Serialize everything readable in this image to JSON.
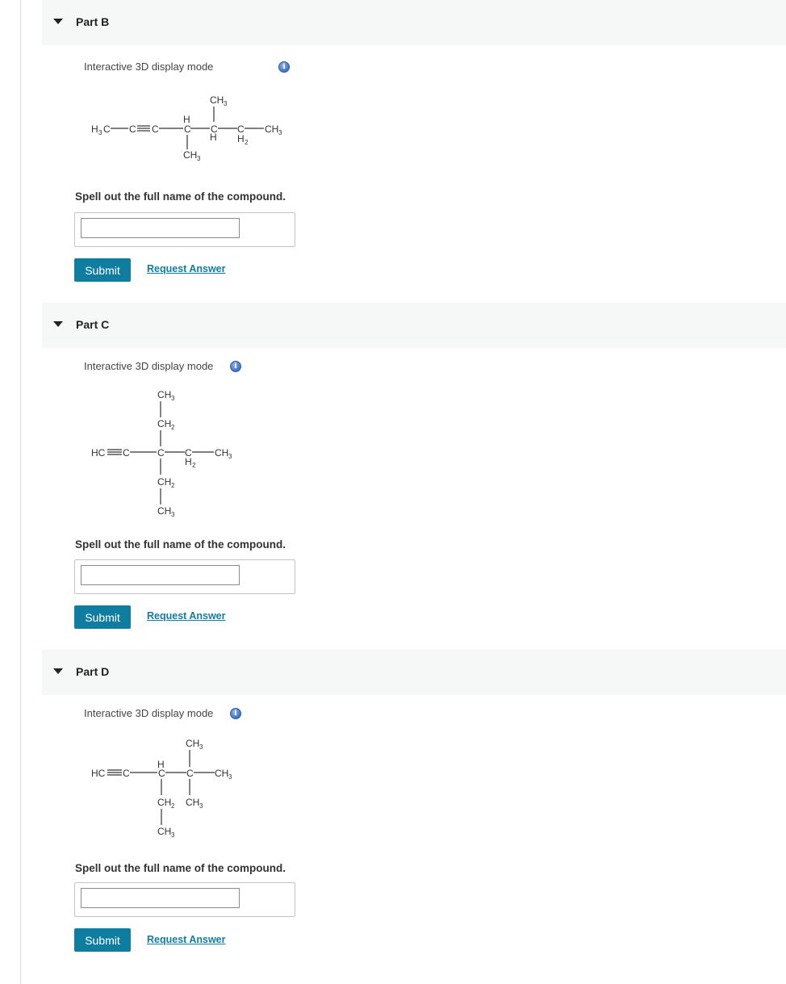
{
  "parts": [
    {
      "title": "Part B",
      "display_mode": "Interactive 3D display mode",
      "info_icon": "info-icon",
      "structure": {
        "left_group": "H",
        "left_group_sub": "3",
        "left_group_end": "C",
        "triple_c": "C",
        "triple_c2": "C",
        "c3": "C",
        "c3_h": "H",
        "c3_sub_ch": "CH",
        "c3_sub_3": "3",
        "c4": "C",
        "c4_h": "H",
        "c4_top_ch": "CH",
        "c4_top_3": "3",
        "c5": "C",
        "c5_h": "H",
        "c5_h_sub": "2",
        "end_ch": "CH",
        "end_3": "3"
      },
      "prompt": "Spell out the full name of the compound.",
      "input_value": "",
      "submit": "Submit",
      "request": "Request Answer"
    },
    {
      "title": "Part C",
      "display_mode": "Interactive 3D display mode",
      "info_icon": "info-icon",
      "structure": {
        "hc": "HC",
        "c2": "C",
        "center_c": "C",
        "top_ch3": "CH",
        "top_3": "3",
        "top_ch2": "CH",
        "top_2": "2",
        "right_c": "C",
        "right_h": "H",
        "right_h_2": "2",
        "end_ch": "CH",
        "end_3": "3",
        "bottom_ch2": "CH",
        "bottom_2": "2",
        "bottom_ch3": "CH",
        "bottom_3": "3"
      },
      "prompt": "Spell out the full name of the compound.",
      "input_value": "",
      "submit": "Submit",
      "request": "Request Answer"
    },
    {
      "title": "Part D",
      "display_mode": "Interactive 3D display mode",
      "info_icon": "info-icon",
      "structure": {
        "hc": "HC",
        "c2": "C",
        "c3": "C",
        "c3_h": "H",
        "c4": "C",
        "top_ch": "CH",
        "top_3": "3",
        "end_ch": "CH",
        "end_3": "3",
        "c3_down_ch": "CH",
        "c3_down_2": "2",
        "c4_down_ch": "CH",
        "c4_down_3": "3",
        "bottom_ch": "CH",
        "bottom_3": "3"
      },
      "prompt": "Spell out the full name of the compound.",
      "input_value": "",
      "submit": "Submit",
      "request": "Request Answer"
    }
  ]
}
